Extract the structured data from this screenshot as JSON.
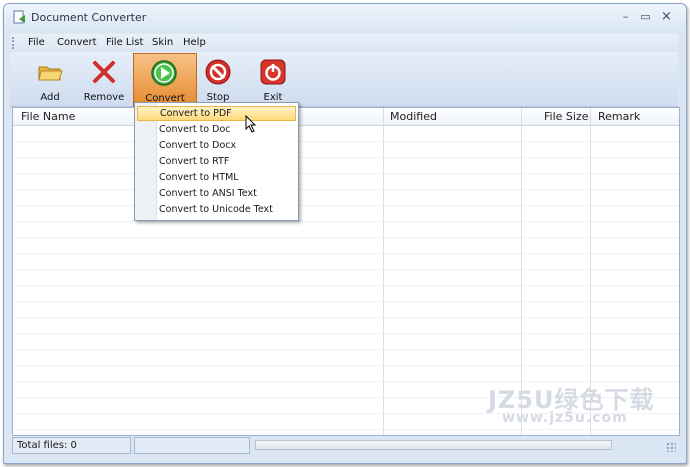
{
  "window": {
    "title": "Document Converter",
    "minimize": "–",
    "maximize": "▭",
    "close": "×"
  },
  "menu": {
    "items": [
      "File",
      "Convert",
      "File List",
      "Skin",
      "Help"
    ]
  },
  "toolbar": {
    "add": "Add",
    "remove": "Remove",
    "convert": "Convert",
    "stop": "Stop",
    "exit": "Exit"
  },
  "list": {
    "columns": [
      "File Name",
      "Modified",
      "File Size",
      "Remark"
    ],
    "rows": []
  },
  "convert_menu": {
    "items": [
      "Convert to PDF",
      "Convert to Doc",
      "Convert to Docx",
      "Convert to RTF",
      "Convert to HTML",
      "Convert to ANSI Text",
      "Convert to Unicode Text"
    ],
    "highlighted": "Convert to PDF"
  },
  "status": {
    "total_files": "Total files: 0"
  },
  "watermark": {
    "line1": "JZ5U绿色下载",
    "line2": "www.jz5u.com"
  },
  "colors": {
    "accent": "#e58a2e",
    "frame": "#dbe6f4",
    "highlight": "#ffd97a"
  }
}
